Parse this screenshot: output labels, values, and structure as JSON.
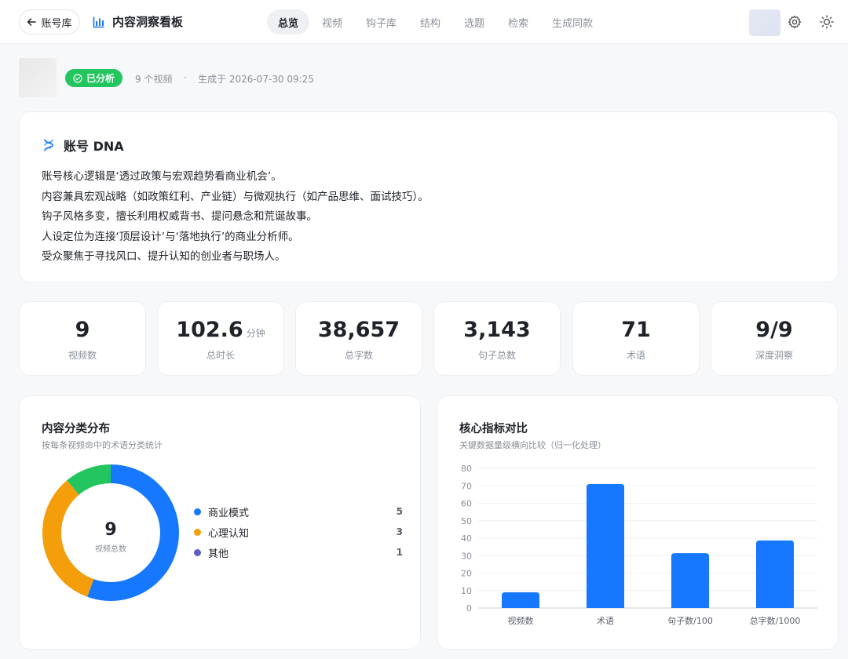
{
  "header": {
    "back_label": "账号库",
    "title": "内容洞察看板",
    "tabs": [
      {
        "label": "总览",
        "active": true
      },
      {
        "label": "视频",
        "active": false
      },
      {
        "label": "钩子库",
        "active": false
      },
      {
        "label": "结构",
        "active": false
      },
      {
        "label": "选题",
        "active": false
      },
      {
        "label": "检索",
        "active": false
      },
      {
        "label": "生成同款",
        "active": false
      }
    ],
    "icons": [
      "arrow-left-icon",
      "bar-chart-icon",
      "gear-icon",
      "sun-icon"
    ]
  },
  "account": {
    "status": "已分析",
    "video_count": "9 个视频",
    "separator": "·",
    "generated": "生成于 2026-07-30 09:25"
  },
  "dna": {
    "title": "账号 DNA",
    "lines": [
      "账号核心逻辑是‘透过政策与宏观趋势看商业机会’。",
      "内容兼具宏观战略（如政策红利、产业链）与微观执行（如产品思维、面试技巧）。",
      "钩子风格多变，擅长利用权威背书、提问悬念和荒诞故事。",
      "人设定位为连接‘顶层设计’与‘落地执行’的商业分析师。",
      "受众聚焦于寻找风口、提升认知的创业者与职场人。"
    ]
  },
  "stats": [
    {
      "value": "9",
      "unit": "",
      "label": "视频数"
    },
    {
      "value": "102.6",
      "unit": "分钟",
      "label": "总时长"
    },
    {
      "value": "38,657",
      "unit": "",
      "label": "总字数"
    },
    {
      "value": "3,143",
      "unit": "",
      "label": "句子总数"
    },
    {
      "value": "71",
      "unit": "",
      "label": "术语"
    },
    {
      "value": "9/9",
      "unit": "",
      "label": "深度洞察"
    }
  ],
  "category_card": {
    "title": "内容分类分布",
    "subtitle": "按每条视频命中的术语分类统计",
    "center_value": "9",
    "center_label": "视频总数",
    "legend": [
      {
        "label": "商业模式",
        "value": "5",
        "color": "#1677ff"
      },
      {
        "label": "心理认知",
        "value": "3",
        "color": "#f59e0b"
      },
      {
        "label": "其他",
        "value": "1",
        "color": "#5b5fc7"
      }
    ]
  },
  "metric_card": {
    "title": "核心指标对比",
    "subtitle": "关键数据量级横向比较（归一化处理）"
  },
  "chart_data": [
    {
      "type": "pie",
      "variant": "donut",
      "slices": [
        {
          "value": 5,
          "color": "#1677ff"
        },
        {
          "value": 3,
          "color": "#f59e0b"
        },
        {
          "value": 1,
          "color": "#22c55e"
        }
      ]
    },
    {
      "type": "bar",
      "categories": [
        "视频数",
        "术语",
        "句子数/100",
        "总字数/1000"
      ],
      "values": [
        9,
        71,
        31.4,
        38.7
      ],
      "ylim": [
        0,
        80
      ],
      "yticks": [
        0,
        10,
        20,
        30,
        40,
        50,
        60,
        70,
        80
      ],
      "grid": true,
      "color": "#1677ff"
    }
  ]
}
